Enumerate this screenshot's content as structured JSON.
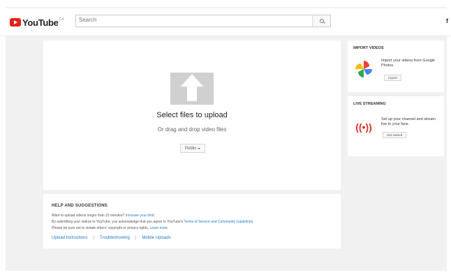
{
  "header": {
    "logo_text": "YouTube",
    "logo_sup": "CA",
    "search_placeholder": "Search",
    "account_initial": "f"
  },
  "upload": {
    "title": "Select files to upload",
    "subtitle": "Or drag and drop video files",
    "privacy_label": "Public"
  },
  "help": {
    "title": "HELP AND SUGGESTIONS",
    "line1_text": "Want to upload videos longer than 15 minutes?",
    "line1_link": "Increase your limit.",
    "line2_text": "By submitting your videos to YouTube, you acknowledge that you agree to YouTube's",
    "line2_link": "Terms of Service and Community Guidelines.",
    "line3_text": "Please be sure not to violate others' copyright or privacy rights.",
    "line3_link": "Learn more",
    "links": [
      "Upload Instructions",
      "Troubleshooting",
      "Mobile Uploads"
    ]
  },
  "import_card": {
    "title": "IMPORT VIDEOS",
    "body": "Import your videos from Google Photos",
    "button": "Import"
  },
  "live_card": {
    "title": "LIVE STREAMING",
    "body": "Set up your channel and stream live to your fans.",
    "button": "Get started"
  },
  "colors": {
    "brand_red": "#e62117",
    "link_blue": "#167ac6",
    "background": "#f1f1f1"
  }
}
